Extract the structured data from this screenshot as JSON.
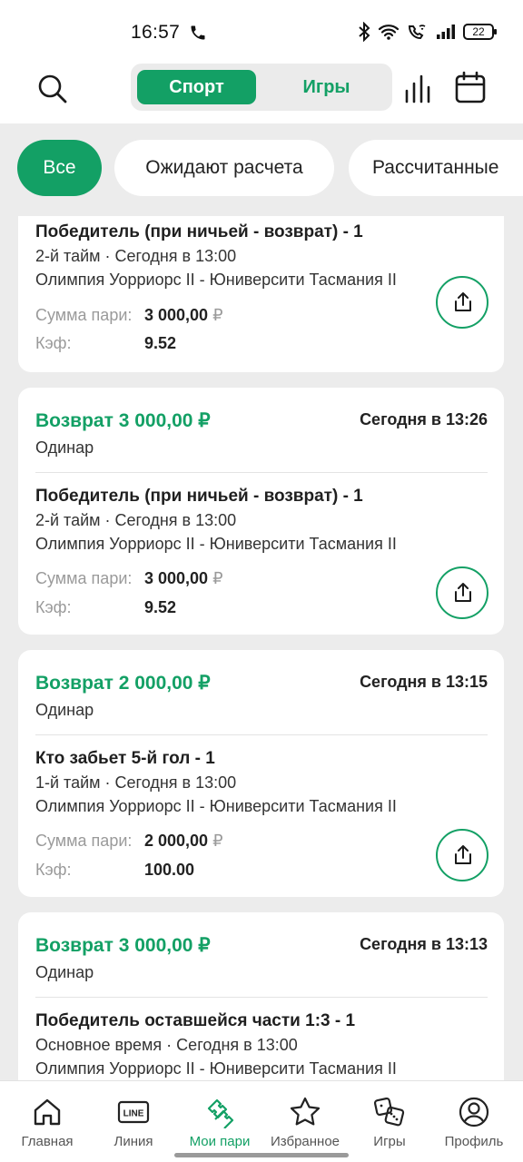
{
  "status_bar": {
    "time": "16:57",
    "battery": "22",
    "icons": [
      "phone-icon",
      "bluetooth-icon",
      "wifi-icon",
      "wifi-call-icon",
      "signal-icon",
      "battery-icon"
    ]
  },
  "header": {
    "tabs": [
      {
        "label": "Спорт",
        "active": true
      },
      {
        "label": "Игры",
        "active": false
      }
    ],
    "icons": [
      "search-icon",
      "stats-icon",
      "calendar-icon"
    ]
  },
  "filters": [
    {
      "label": "Все",
      "active": true
    },
    {
      "label": "Ожидают расчета",
      "active": false
    },
    {
      "label": "Рассчитанные",
      "active": false
    }
  ],
  "bets": [
    {
      "market": "Победитель (при ничьей - возврат) - 1",
      "period": "2-й тайм · Сегодня в 13:00",
      "match": "Олимпия Уорриорс II - Юниверсити Тасмания II",
      "amount_label": "Сумма пари:",
      "amount": "3 000,00",
      "currency": "₽",
      "odds_label": "Кэф:",
      "odds": "9.52"
    },
    {
      "status": "Возврат 3 000,00 ₽",
      "time": "Сегодня в 13:26",
      "type": "Одинар",
      "market": "Победитель (при ничьей - возврат) - 1",
      "period": "2-й тайм · Сегодня в 13:00",
      "match": "Олимпия Уорриорс II - Юниверсити Тасмания II",
      "amount_label": "Сумма пари:",
      "amount": "3 000,00",
      "currency": "₽",
      "odds_label": "Кэф:",
      "odds": "9.52"
    },
    {
      "status": "Возврат 2 000,00 ₽",
      "time": "Сегодня в 13:15",
      "type": "Одинар",
      "market": "Кто забьет 5-й гол - 1",
      "period": "1-й тайм · Сегодня в 13:00",
      "match": "Олимпия Уорриорс II - Юниверсити Тасмания II",
      "amount_label": "Сумма пари:",
      "amount": "2 000,00",
      "currency": "₽",
      "odds_label": "Кэф:",
      "odds": "100.00"
    },
    {
      "status": "Возврат 3 000,00 ₽",
      "time": "Сегодня в 13:13",
      "type": "Одинар",
      "market": "Победитель оставшейся части 1:3 - 1",
      "period": "Основное время · Сегодня в 13:00",
      "match": "Олимпия Уорриорс II - Юниверсити Тасмания II"
    }
  ],
  "bottom_nav": [
    {
      "label": "Главная",
      "icon": "home-icon",
      "active": false
    },
    {
      "label": "Линия",
      "icon": "line-icon",
      "icon_text": "LINE",
      "active": false
    },
    {
      "label": "Мои пари",
      "icon": "tickets-icon",
      "active": true
    },
    {
      "label": "Избранное",
      "icon": "star-icon",
      "active": false
    },
    {
      "label": "Игры",
      "icon": "dice-icon",
      "active": false
    },
    {
      "label": "Профиль",
      "icon": "profile-icon",
      "active": false
    }
  ],
  "colors": {
    "accent": "#13a065",
    "background": "#ececec",
    "muted": "#9a9a9a"
  }
}
